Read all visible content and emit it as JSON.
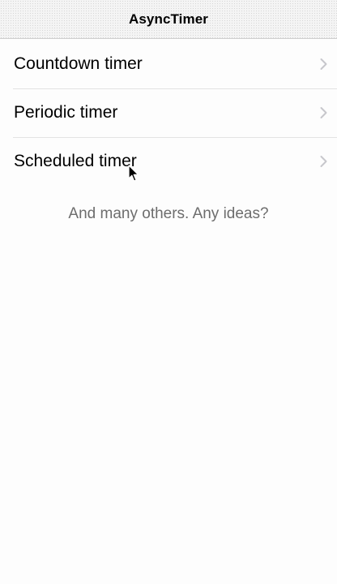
{
  "navbar": {
    "title": "AsyncTimer"
  },
  "list": {
    "items": [
      {
        "label": "Countdown timer",
        "accessory": "chevron-right-icon"
      },
      {
        "label": "Periodic timer",
        "accessory": "chevron-right-icon"
      },
      {
        "label": "Scheduled timer",
        "accessory": "chevron-right-icon"
      }
    ]
  },
  "footer": {
    "note": "And many others. Any ideas?"
  },
  "colors": {
    "chevron": "#c7c7cc",
    "separator": "#e3e3e3",
    "note_text": "#6d6d6d"
  }
}
